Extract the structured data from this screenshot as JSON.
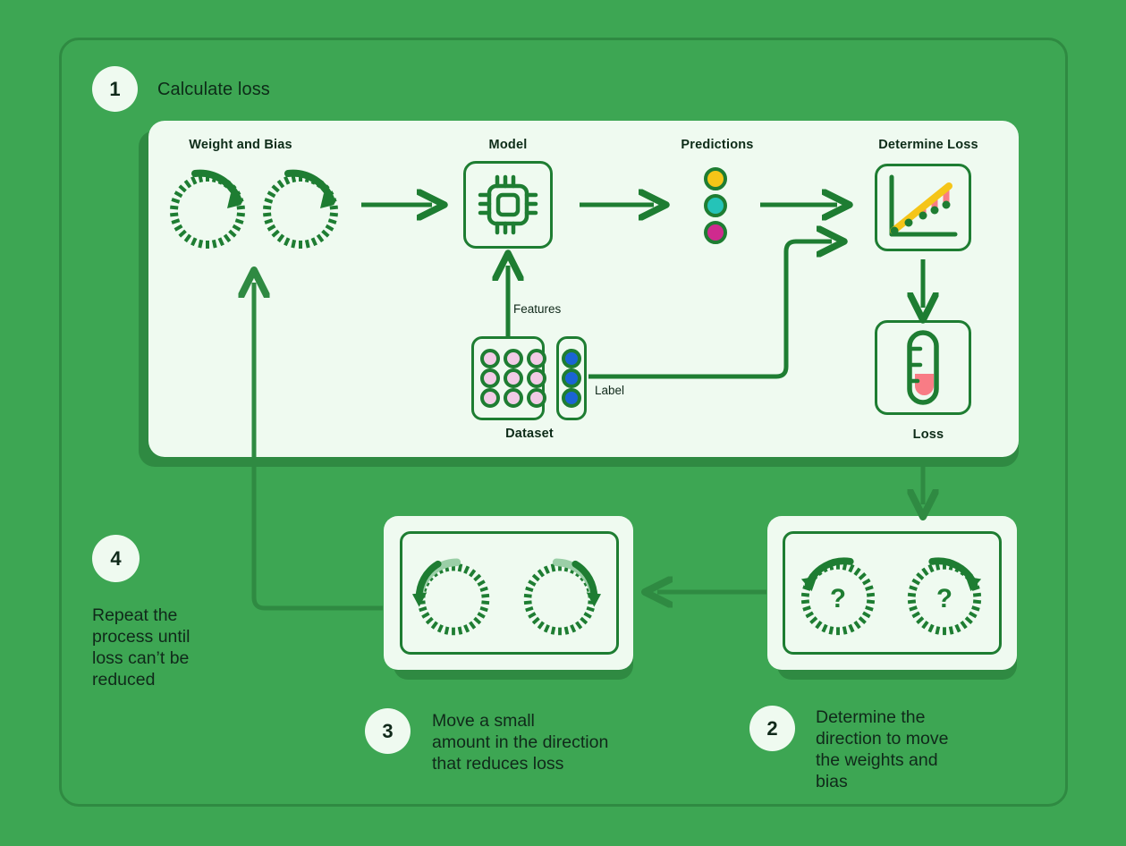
{
  "theme": {
    "background": "#3da653",
    "frame_border": "#2f8a42",
    "card_bg": "#effaf0",
    "card_shadow": "#2f8a42",
    "stroke_green": "#1e7d32",
    "text_dark": "#10291a",
    "yellow": "#f5c518",
    "cyan": "#25c3b8",
    "magenta": "#cf2a8e",
    "pink_fill": "#f87c85",
    "feature_pink": "#f2cbe6",
    "label_blue": "#1a64d4"
  },
  "steps": [
    {
      "number": "1",
      "title": "Calculate loss"
    },
    {
      "number": "2",
      "title": "Determine the\ndirection to move\nthe weights and\nbias"
    },
    {
      "number": "3",
      "title": "Move a small\namount in the direction\nthat reduces loss"
    },
    {
      "number": "4",
      "title": "Repeat the\nprocess until\nloss can’t be\nreduced"
    }
  ],
  "step1": {
    "sections": {
      "weight_and_bias": "Weight and Bias",
      "model": "Model",
      "predictions": "Predictions",
      "determine_loss": "Determine Loss",
      "loss": "Loss",
      "dataset": "Dataset"
    },
    "connector_labels": {
      "features": "Features",
      "label": "Label"
    },
    "prediction_dots": [
      {
        "name": "prediction-dot-yellow",
        "color": "#f5c518"
      },
      {
        "name": "prediction-dot-cyan",
        "color": "#25c3b8"
      },
      {
        "name": "prediction-dot-magenta",
        "color": "#cf2a8e"
      }
    ],
    "feature_dot_color": "#f2cbe6",
    "feature_dot_count": 9,
    "label_dot_color": "#1a64d4",
    "label_dot_count": 3,
    "loss_meter": {
      "fill_color": "#f87c85",
      "fill_level": "low"
    },
    "loss_chart": {
      "line_color": "#f5c518",
      "point_color": "#1e7d32",
      "error_color": "#f87c85",
      "point_count": 5
    }
  },
  "step2_card": {
    "dial_symbol": "?",
    "dials": [
      {
        "name": "dial-weight-unknown",
        "direction": "counter-clockwise"
      },
      {
        "name": "dial-bias-unknown",
        "direction": "clockwise"
      }
    ]
  },
  "step3_card": {
    "dials": [
      {
        "name": "dial-weight-adjust",
        "direction": "counter-clockwise"
      },
      {
        "name": "dial-bias-adjust",
        "direction": "clockwise"
      }
    ]
  }
}
